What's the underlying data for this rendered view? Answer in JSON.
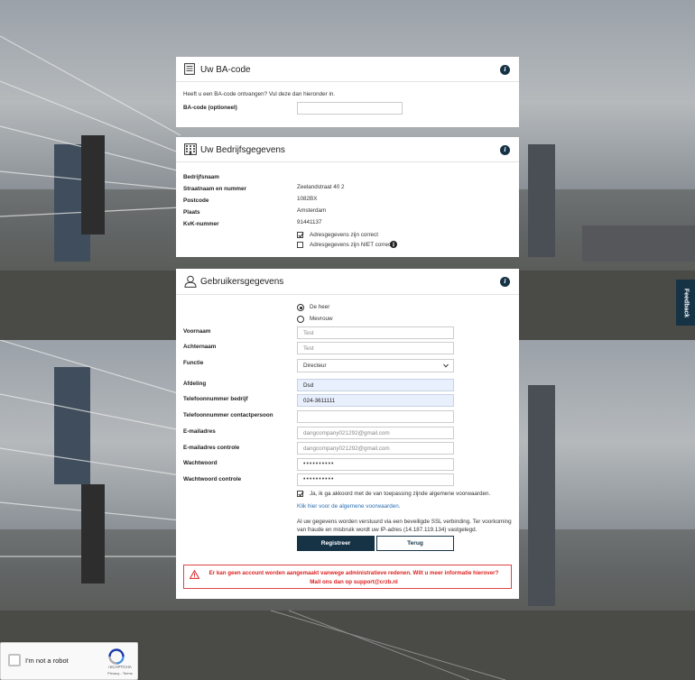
{
  "ba_code": {
    "title": "Uw BA-code",
    "intro": "Heeft u een BA-code ontvangen? Vul deze dan hieronder in.",
    "field_label": "BA-code (optioneel)",
    "field_value": ""
  },
  "company": {
    "title": "Uw Bedrijfsgegevens",
    "rows": [
      {
        "label": "Bedrijfsnaam",
        "value": ""
      },
      {
        "label": "Straatnaam en nummer",
        "value": "Zeelandstraat 40 2"
      },
      {
        "label": "Postcode",
        "value": "1082BX"
      },
      {
        "label": "Plaats",
        "value": "Amsterdam"
      },
      {
        "label": "KvK-nummer",
        "value": "91441137"
      }
    ],
    "address_correct": "Adresgegevens zijn correct",
    "address_incorrect": "Adresgegevens zijn NIET correct"
  },
  "user": {
    "title": "Gebruikersgegevens",
    "salutation_mr": "De heer",
    "salutation_mrs": "Mevrouw",
    "fields": {
      "voornaam": {
        "label": "Voornaam",
        "value": "Test"
      },
      "achternaam": {
        "label": "Achternaam",
        "value": "Test"
      },
      "functie": {
        "label": "Functie",
        "value": "Directeur"
      },
      "afdeling": {
        "label": "Afdeling",
        "value": "Dsd"
      },
      "tel_bedrijf": {
        "label": "Telefoonnummer bedrijf",
        "value": "024-3611111"
      },
      "tel_contact": {
        "label": "Telefoonnummer contactpersoon",
        "value": ""
      },
      "email": {
        "label": "E-mailadres",
        "value": "dangcompany021292@gmail.com"
      },
      "email_check": {
        "label": "E-mailadres controle",
        "value": "dangcompany021292@gmail.com"
      },
      "password": {
        "label": "Wachtwoord",
        "value": "••••••••••"
      },
      "password_check": {
        "label": "Wachtwoord controle",
        "value": "••••••••••"
      }
    },
    "terms_agree": "Ja, ik ga akkoord met de van toepassing zijnde algemene voorwaarden.",
    "terms_link": "Klik hier voor de algemene voorwaarden.",
    "ssl_notice": "Al uw gegevens worden verstuurd via een beveiligde SSL verbinding. Ter voorkoming van fraude en misbruik wordt uw IP-adres (14.187.119.134) vastgelegd.",
    "register_button": "Registreer",
    "back_button": "Terug",
    "error_message": "Er kan geen account worden aangemaakt vanwege administratieve redenen. Wilt u meer informatie hierover? Mail ons dan op support@crzb.nl"
  },
  "feedback_tab": "Feedback",
  "recaptcha": {
    "label": "I'm not a robot",
    "brand": "reCAPTCHA",
    "links": "Privacy - Terms"
  },
  "colors": {
    "primary": "#163346",
    "error": "#dd2222",
    "link": "#2a6fb0"
  }
}
